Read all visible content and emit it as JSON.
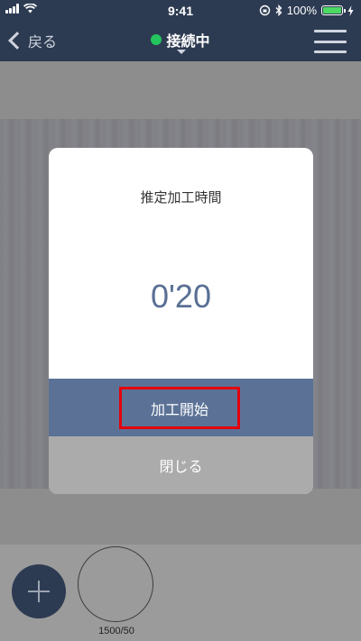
{
  "status_bar": {
    "time": "9:41",
    "battery_percent_text": "100%",
    "battery_level": 1.0,
    "icons": [
      "signal-icon",
      "wifi-icon",
      "orientation-lock-icon",
      "bluetooth-icon",
      "battery-icon",
      "charging-icon"
    ]
  },
  "nav": {
    "back_label": "戻る",
    "connection_label": "接続中",
    "connection_color": "#22c55e",
    "menu_icon": "hamburger-menu-icon"
  },
  "modal": {
    "title": "推定加工時間",
    "time_value": "0'20",
    "start_button_label": "加工開始",
    "close_button_label": "閉じる"
  },
  "bottom": {
    "add_icon": "plus-icon",
    "preset_label": "1500/50"
  },
  "colors": {
    "header_bg": "#2d3b52",
    "accent_blue": "#5b7296",
    "highlight_red": "#e3000b"
  }
}
